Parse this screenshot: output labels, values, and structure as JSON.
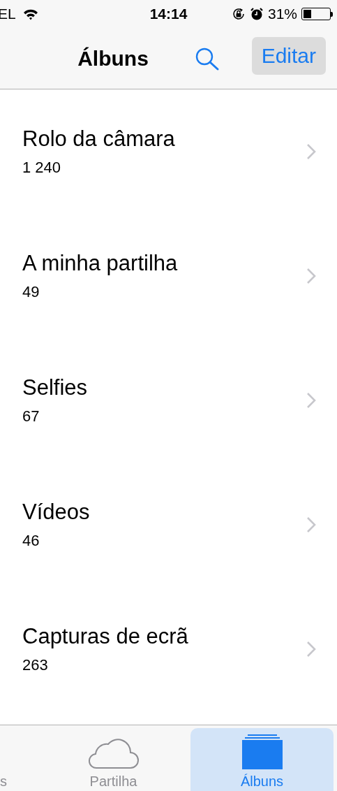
{
  "status_bar": {
    "carrier": "EL",
    "time": "14:14",
    "battery_percent": "31%"
  },
  "nav_bar": {
    "title": "Álbuns",
    "edit_button": "Editar"
  },
  "albums": [
    {
      "name": "Rolo da câmara",
      "count": "1 240"
    },
    {
      "name": "A minha partilha",
      "count": "49"
    },
    {
      "name": "Selfies",
      "count": "67"
    },
    {
      "name": "Vídeos",
      "count": "46"
    },
    {
      "name": "Capturas de ecrã",
      "count": "263"
    }
  ],
  "tab_bar": [
    {
      "label": "s",
      "kind": "cut",
      "selected": false
    },
    {
      "label": "Partilha",
      "kind": "cloud",
      "selected": false
    },
    {
      "label": "Álbuns",
      "kind": "albums",
      "selected": true
    }
  ]
}
